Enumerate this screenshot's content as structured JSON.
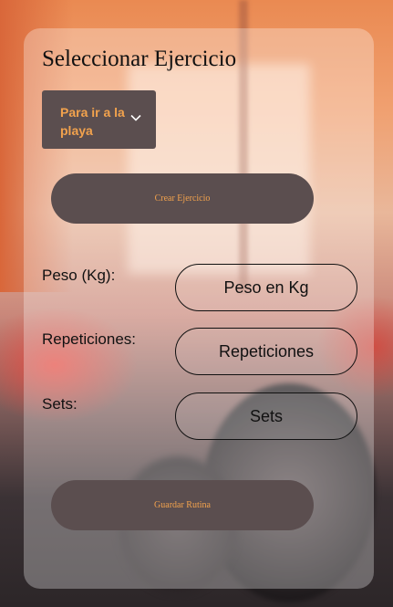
{
  "header": {
    "title": "Seleccionar Ejercicio"
  },
  "exercise_select": {
    "selected": "Para ir a la playa",
    "icon": "chevron-down-icon"
  },
  "buttons": {
    "create_label": "Crear Ejercicio",
    "save_label": "Guardar Rutina"
  },
  "fields": [
    {
      "label": "Peso (Kg):",
      "placeholder": "Peso en Kg"
    },
    {
      "label": "Repeticiones:",
      "placeholder": "Repeticiones"
    },
    {
      "label": "Sets:",
      "placeholder": "Sets"
    }
  ],
  "colors": {
    "accent": "#f2a24d",
    "button_bg": "#5b4e4f"
  }
}
